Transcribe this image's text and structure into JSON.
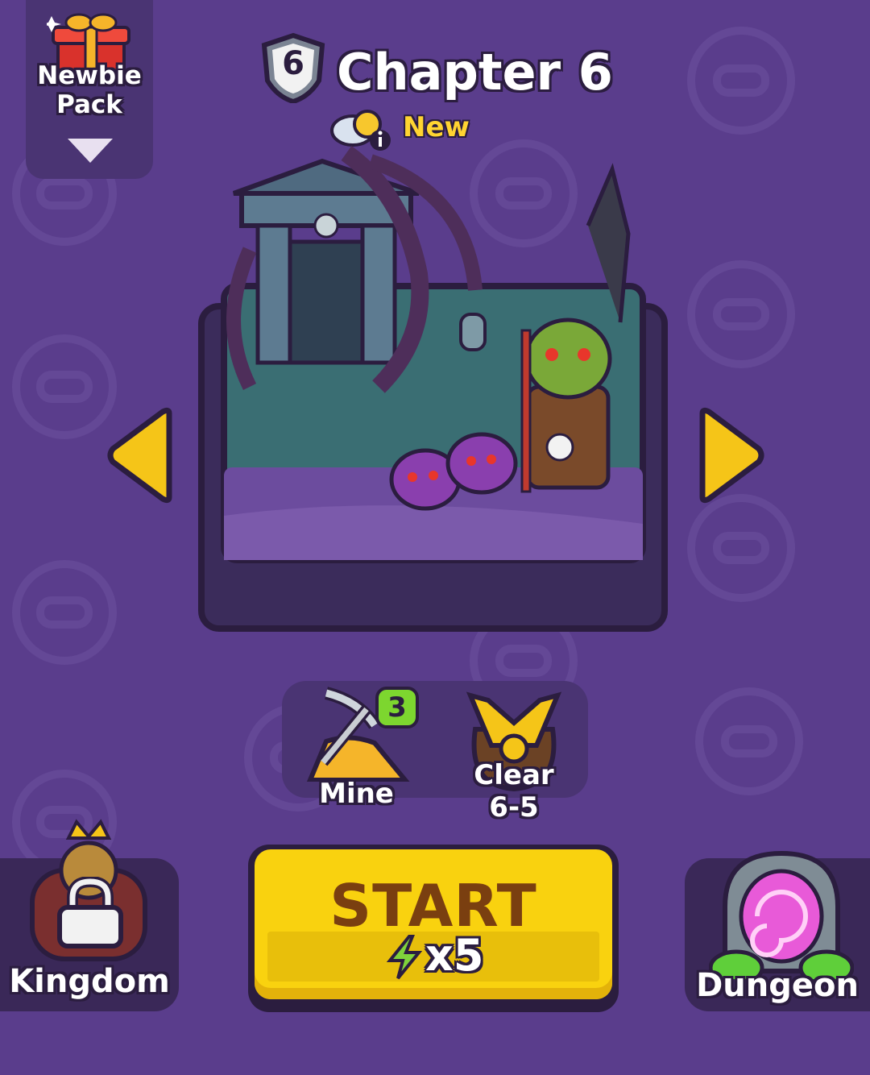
{
  "newbie_pack": {
    "label": "Newbie Pack"
  },
  "chapter": {
    "number": "6",
    "title": "Chapter 6",
    "status": "New"
  },
  "rewards": {
    "mine": {
      "label": "Mine",
      "count": "3"
    },
    "clear": {
      "label": "Clear",
      "stage": "6-5"
    }
  },
  "start": {
    "label": "START",
    "cost": "x5"
  },
  "kingdom": {
    "label": "Kingdom"
  },
  "dungeon": {
    "label": "Dungeon"
  },
  "icons": {
    "gift": "gift-box-icon",
    "shield": "shield-badge-icon",
    "weather": "cloud-sun-info-icon",
    "pickaxe": "pickaxe-gold-icon",
    "chest": "treasure-pouch-icon",
    "lock": "lock-icon",
    "energy": "lightning-bolt-icon",
    "portal": "portal-icon",
    "left": "arrow-left-icon",
    "right": "arrow-right-icon"
  },
  "colors": {
    "background": "#5a3d8c",
    "accent": "#f9d20f",
    "new_label": "#ffd431"
  }
}
